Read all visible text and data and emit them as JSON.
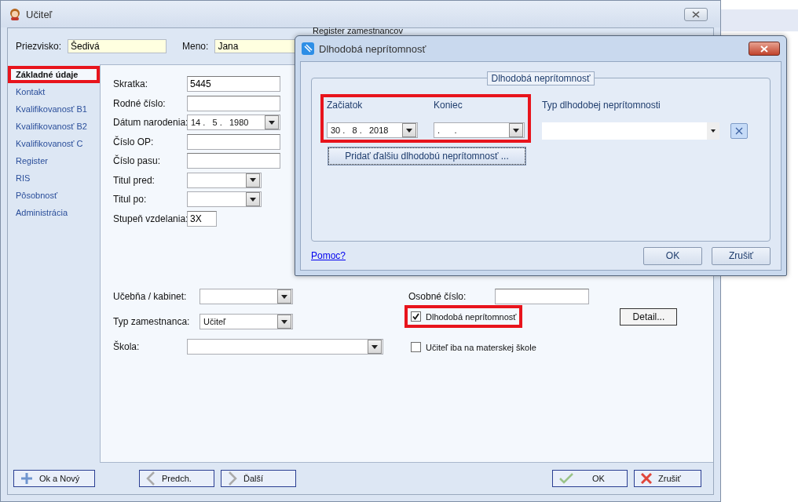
{
  "window": {
    "title": "Učiteľ"
  },
  "header": {
    "surname_label": "Priezvisko:",
    "surname": "Šedivá",
    "name_label": "Meno:",
    "name": "Jana",
    "hidden_label": "Register zamestnancov"
  },
  "sidebar": {
    "items": [
      {
        "label": "Základné údaje",
        "selected": true,
        "highlighted": true
      },
      {
        "label": "Kontakt",
        "selected": false,
        "highlighted": false
      },
      {
        "label": "Kvalifikovanosť B1",
        "selected": false,
        "highlighted": false
      },
      {
        "label": "Kvalifikovanosť B2",
        "selected": false,
        "highlighted": false
      },
      {
        "label": "Kvalifikovanosť C",
        "selected": false,
        "highlighted": false
      },
      {
        "label": "Register",
        "selected": false,
        "highlighted": false
      },
      {
        "label": "RIS",
        "selected": false,
        "highlighted": false
      },
      {
        "label": "Pôsobnosť",
        "selected": false,
        "highlighted": false
      },
      {
        "label": "Administrácia",
        "selected": false,
        "highlighted": false
      }
    ]
  },
  "form": {
    "fields": [
      {
        "kind": "text",
        "label": "Skratka:",
        "value": "5445"
      },
      {
        "kind": "text",
        "label": "Rodné číslo:"
      },
      {
        "kind": "date",
        "label": "Dátum narodenia:",
        "value": "14 .   5 .   1980"
      },
      {
        "kind": "text",
        "label": "Číslo OP:"
      },
      {
        "kind": "text",
        "label": "Číslo pasu:"
      },
      {
        "kind": "combo",
        "label": "Titul pred:"
      },
      {
        "kind": "combo",
        "label": "Titul po:"
      },
      {
        "kind": "short",
        "label": "Stupeň vzdelania:",
        "value": "3X"
      }
    ],
    "lower_fields": [
      {
        "kind": "combo",
        "label": "Učebňa / kabinet:"
      },
      {
        "kind": "combo",
        "label": "Typ zamestnanca:",
        "value": "Učiteľ"
      },
      {
        "kind": "combo",
        "label": "Škola:"
      }
    ],
    "personal_number_label": "Osobné číslo:",
    "checkboxes": [
      {
        "label": "Dlhodobá neprítomnosť",
        "checked": true,
        "highlighted": true
      },
      {
        "label": "Učiteľ iba na materskej škole",
        "checked": false,
        "highlighted": false
      }
    ],
    "detail_button": "Detail..."
  },
  "footer": {
    "buttons": [
      {
        "kind": "add",
        "label": "Ok a Nový"
      },
      {
        "kind": "prev",
        "label": "Predch."
      },
      {
        "kind": "next",
        "label": "Ďalší"
      },
      {
        "kind": "ok",
        "label": "OK"
      },
      {
        "kind": "cancel",
        "label": "Zrušiť"
      }
    ]
  },
  "dialog": {
    "title": "Dlhodobá neprítomnosť",
    "group_title": "Dlhodobá neprítomnosť",
    "dates_highlighted": true,
    "start": {
      "label": "Začiatok",
      "value": "30 .   8 .   2018"
    },
    "end": {
      "label": "Koniec",
      "value": ".      ."
    },
    "type_label": "Typ dlhodobej neprítomnosti",
    "add_button": "Pridať ďalšiu dlhodobú neprítomnosť ...",
    "help_link": "Pomoc?",
    "ok_button": "OK",
    "cancel_button": "Zrušiť"
  }
}
